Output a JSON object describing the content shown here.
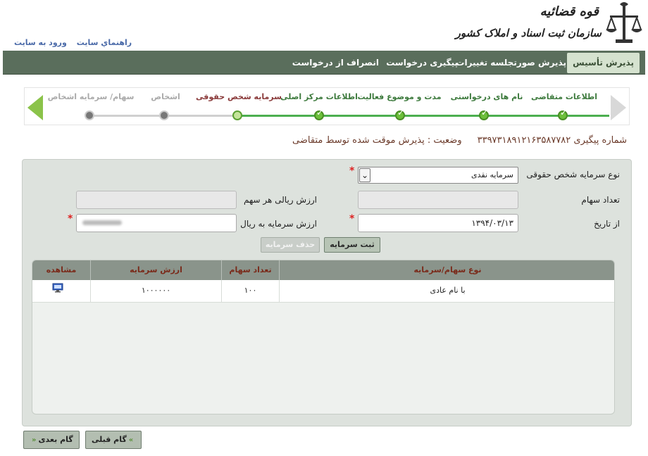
{
  "header": {
    "logo_line1": "قوه قضائیه",
    "logo_line2": "سازمان ثبت اسناد و املاک کشور",
    "links": [
      "راهنماي سايت",
      "ورود به سايت"
    ]
  },
  "nav": {
    "items": [
      {
        "label": "پذیرش تأسیس",
        "active": true
      },
      {
        "label": "پذیرش صورتجلسه تغییرات",
        "active": false
      },
      {
        "label": "پیگیری درخواست",
        "active": false
      },
      {
        "label": "انصراف از درخواست",
        "active": false
      }
    ]
  },
  "steps": [
    {
      "label": "اطلاعات متقاضی",
      "state": "done"
    },
    {
      "label": "نام های درخواستی",
      "state": "done"
    },
    {
      "label": "مدت و موضوع فعالیت",
      "state": "done"
    },
    {
      "label": "اطلاعات مرکز اصلی",
      "state": "done"
    },
    {
      "label": "سرمایه شخص حقوقی",
      "state": "current"
    },
    {
      "label": "اشخاص",
      "state": "pending"
    },
    {
      "label": "سهام/ سرمایه اشخاص",
      "state": "pending"
    }
  ],
  "tracking": {
    "number_text": "شماره پیگیری ۳۳۹۷۳۱۸۹۱۲۱۶۳۵۸۷۷۸۲",
    "status_text": "وضعیت : پذیرش موقت شده توسط متقاضی"
  },
  "form": {
    "capital_type_label": "نوع سرمایه شخص حقوقی",
    "capital_type_value": "سرمایه نقدی",
    "share_count_label": "تعداد سهام",
    "share_value_label": "ارزش ریالی هر سهم",
    "date_label": "از تاریخ",
    "date_value": "۱۳۹۴/۰۳/۱۳",
    "capital_rial_label": "ارزش سرمایه به ریال",
    "required_mark": "*",
    "register_btn": "ثبت سرمایه",
    "delete_btn": "حذف سرمایه"
  },
  "table": {
    "headers": {
      "share_type": "نوع سهام/سرمایه",
      "share_count": "تعداد سهام",
      "capital_value": "ارزش سرمایه",
      "view": "مشاهده"
    },
    "rows": [
      {
        "share_type": "با نام عادی",
        "share_count": "۱۰۰",
        "capital_value": "۱۰۰۰۰۰۰"
      }
    ]
  },
  "footer": {
    "prev_btn": "گام قبلی",
    "next_btn": "گام بعدی"
  },
  "colors": {
    "navbar": "#5a6e5c",
    "progress_green": "#4caf50",
    "panel": "#dde2dd",
    "table_header": "#8a948b"
  }
}
